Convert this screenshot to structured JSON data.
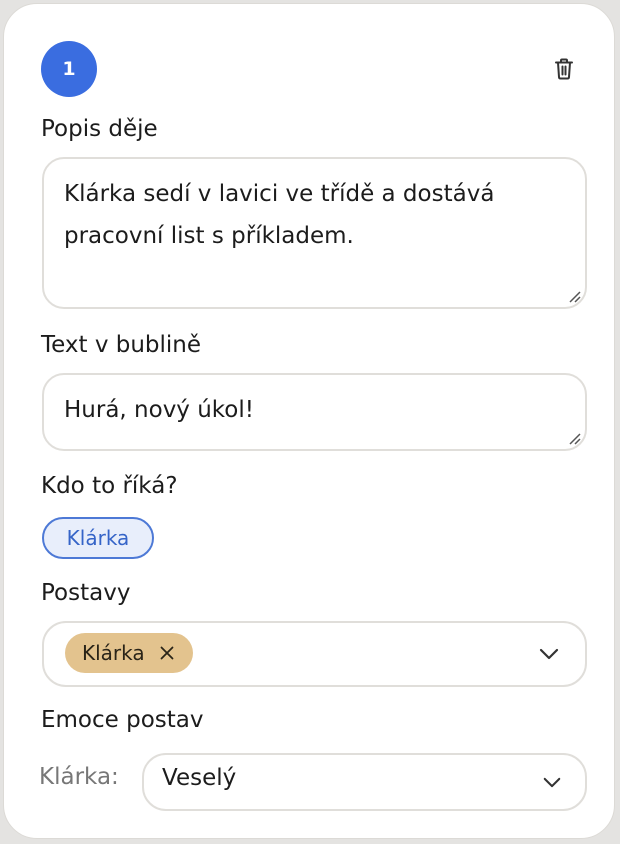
{
  "step": {
    "number": "1"
  },
  "actions": {
    "delete_icon": "trash-icon"
  },
  "description": {
    "label": "Popis děje",
    "value": "Klárka sedí v lavici ve třídě a dostává pracovní list s příkladem."
  },
  "bubble": {
    "label": "Text v bublině",
    "value": "Hurá, nový úkol!"
  },
  "speaker": {
    "label": "Kdo to říká?",
    "selected": "Klárka"
  },
  "characters": {
    "label": "Postavy",
    "tags": [
      "Klárka"
    ],
    "remove_icon": "close-icon",
    "dropdown_icon": "chevron-down-icon"
  },
  "emotions": {
    "label": "Emoce postav",
    "rows": [
      {
        "character": "Klárka:",
        "value": "Veselý"
      }
    ]
  },
  "colors": {
    "accent": "#3a6de0",
    "chip_border": "#4d79d6",
    "chip_bg": "#e8eefb",
    "tag_bg": "#e3c38e"
  }
}
